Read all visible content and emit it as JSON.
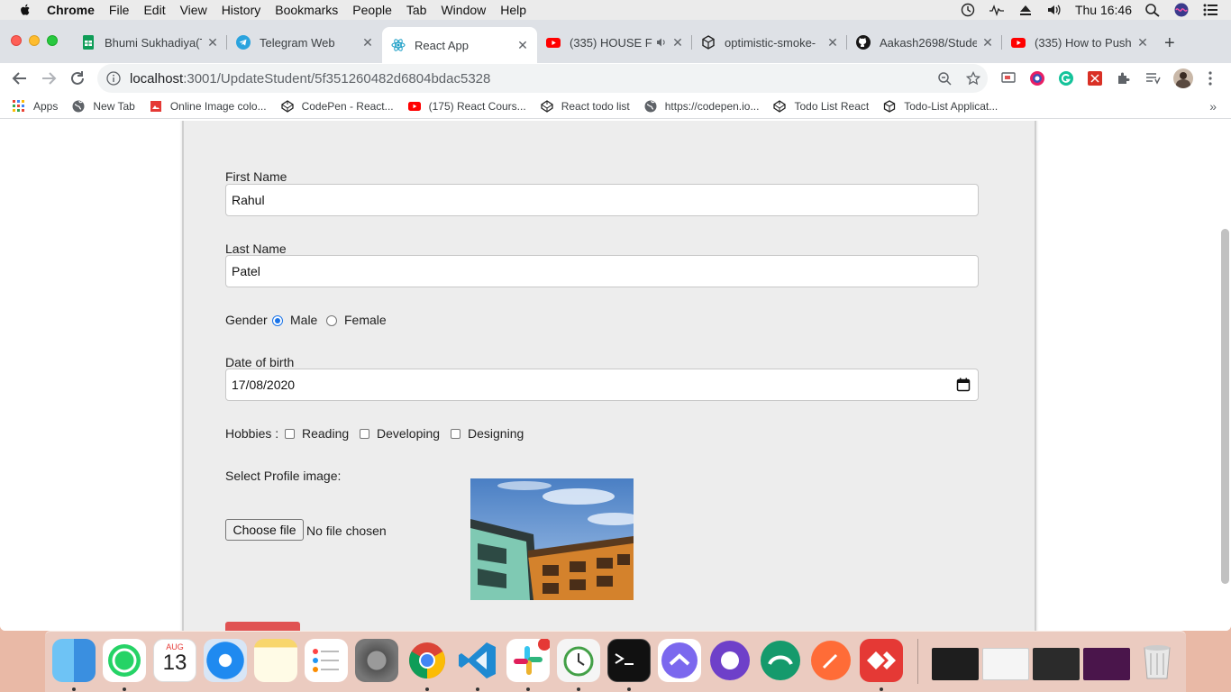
{
  "menubar": {
    "app": "Chrome",
    "items": [
      "File",
      "Edit",
      "View",
      "History",
      "Bookmarks",
      "People",
      "Tab",
      "Window",
      "Help"
    ],
    "clock": "Thu 16:46"
  },
  "tabs": [
    {
      "title": "Bhumi Sukhadiya(T",
      "icon": "google-sheets-icon"
    },
    {
      "title": "Telegram Web",
      "icon": "telegram-icon"
    },
    {
      "title": "React App",
      "icon": "react-icon",
      "active": true
    },
    {
      "title": "(335) HOUSE F",
      "icon": "youtube-icon"
    },
    {
      "title": "optimistic-smoke-",
      "icon": "codesandbox-icon"
    },
    {
      "title": "Aakash2698/Stude",
      "icon": "github-icon"
    },
    {
      "title": "(335) How to Push",
      "icon": "youtube-icon"
    }
  ],
  "address": {
    "host": "localhost",
    "path": ":3001/UpdateStudent/5f351260482d6804bdac5328"
  },
  "bookmarks": [
    {
      "label": "Apps",
      "icon": "apps-grid-icon"
    },
    {
      "label": "New Tab",
      "icon": "globe-icon"
    },
    {
      "label": "Online Image colo...",
      "icon": "image-icon"
    },
    {
      "label": "CodePen - React...",
      "icon": "codepen-icon"
    },
    {
      "label": "(175) React Cours...",
      "icon": "youtube-icon"
    },
    {
      "label": "React todo list",
      "icon": "codepen-icon"
    },
    {
      "label": "https://codepen.io...",
      "icon": "globe-icon"
    },
    {
      "label": "Todo List React",
      "icon": "codepen-icon"
    },
    {
      "label": "Todo-List Applicat...",
      "icon": "codesandbox-icon"
    }
  ],
  "form": {
    "first_name_label": "First Name",
    "first_name_value": "Rahul",
    "last_name_label": "Last Name",
    "last_name_value": "Patel",
    "gender_label": "Gender",
    "gender_options": [
      "Male",
      "Female"
    ],
    "gender_selected": "Male",
    "dob_label": "Date of birth",
    "dob_value": "17/08/2020",
    "hobbies_label": "Hobbies :",
    "hobbies": [
      "Reading",
      "Developing",
      "Designing"
    ],
    "profile_label": "Select Profile image:",
    "file_button": "Choose file",
    "file_status": "No file chosen"
  },
  "dock": {
    "calendar_month": "AUG",
    "calendar_day": "13"
  },
  "colors": {
    "accent_blue": "#1a73e8",
    "submit_red": "#e05252",
    "card_bg": "#ededed"
  }
}
